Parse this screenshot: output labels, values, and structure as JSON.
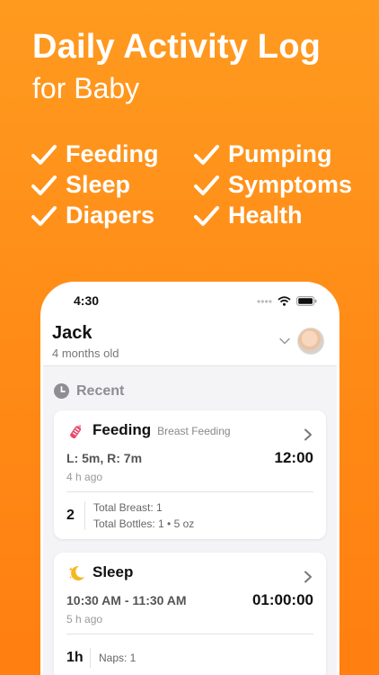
{
  "headline": {
    "title": "Daily Activity Log",
    "subtitle": "for Baby"
  },
  "features": [
    "Feeding",
    "Pumping",
    "Sleep",
    "Symptoms",
    "Diapers",
    "Health"
  ],
  "phone": {
    "status_time": "4:30",
    "profile": {
      "name": "Jack",
      "age": "4 months old"
    },
    "recent_label": "Recent",
    "cards": [
      {
        "title": "Feeding",
        "subtitle": "Breast Feeding",
        "detail": "L: 5m, R: 7m",
        "time_value": "12:00",
        "ago": "4 h ago",
        "count": "2",
        "stat_lines": [
          "Total Breast: 1",
          "Total Bottles: 1 • 5 oz"
        ]
      },
      {
        "title": "Sleep",
        "subtitle": "",
        "detail": "10:30 AM - 11:30 AM",
        "time_value": "01:00:00",
        "ago": "5 h ago",
        "count": "1h",
        "stat_lines": [
          "Naps: 1"
        ]
      }
    ]
  },
  "colors": {
    "background": "#FF8A16",
    "feeding_icon": "#E8476A",
    "sleep_icon": "#F4B820"
  }
}
